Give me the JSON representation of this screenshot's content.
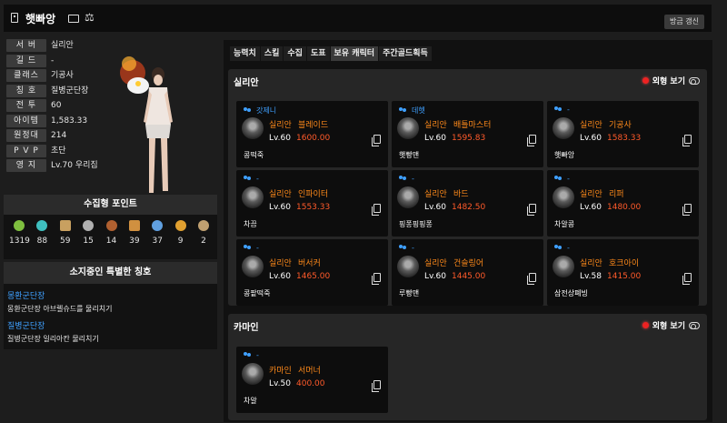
{
  "header": {
    "name": "햇빠앙",
    "refresh_label": "방금 갱신"
  },
  "profile": {
    "rows": [
      {
        "label": "서 버",
        "value": "실리안"
      },
      {
        "label": "길 드",
        "value": "-"
      },
      {
        "label": "클래스",
        "value": "기공사"
      },
      {
        "label": "칭 호",
        "value": "질병군단장"
      },
      {
        "label": "전 투",
        "value": "60"
      },
      {
        "label": "아이템",
        "value": "1,583.33"
      },
      {
        "label": "원정대",
        "value": "214"
      },
      {
        "label": "P V P",
        "value": "초단"
      },
      {
        "label": "영 지",
        "value": "Lv.70 우리집"
      }
    ]
  },
  "collect": {
    "title": "수집형 포인트",
    "items": [
      {
        "icon": "mokoko-seed-icon",
        "value": "1319",
        "color": "#7fbf3f"
      },
      {
        "icon": "island-heart-icon",
        "value": "88",
        "color": "#3fbfbf"
      },
      {
        "icon": "masterpiece-icon",
        "value": "59",
        "color": "#c8a060"
      },
      {
        "icon": "giants-heart-icon",
        "value": "15",
        "color": "#b0b0b0"
      },
      {
        "icon": "ignea-token-icon",
        "value": "14",
        "color": "#b06030"
      },
      {
        "icon": "voyage-icon",
        "value": "39",
        "color": "#d09040"
      },
      {
        "icon": "world-tree-leaf-icon",
        "value": "37",
        "color": "#60a0e0"
      },
      {
        "icon": "orpheus-star-icon",
        "value": "9",
        "color": "#e0a030"
      },
      {
        "icon": "sea-bounty-icon",
        "value": "2",
        "color": "#c0a070"
      }
    ]
  },
  "special_titles": {
    "title": "소지중인 특별한 칭호",
    "items": [
      {
        "name": "몽환군단장",
        "desc": "몽환군단장 아브렐슈드를 물리치기"
      },
      {
        "name": "질병군단장",
        "desc": "질병군단장 일리아칸 물리치기"
      }
    ]
  },
  "tabs": [
    "능력치",
    "스킬",
    "수집",
    "도표",
    "보유 캐릭터",
    "주간골드획득"
  ],
  "active_tab": "보유 캐릭터",
  "servers": [
    {
      "name": "실리안",
      "toggle_label": "외형 보기",
      "characters": [
        {
          "guild": "갓제니",
          "server": "실리안",
          "class": "블레이드",
          "level": "Lv.60",
          "item_level": "1600.00",
          "name": "콩떡죽"
        },
        {
          "guild": "데헷",
          "server": "실리안",
          "class": "배틀마스터",
          "level": "Lv.60",
          "item_level": "1595.83",
          "name": "햇빵맨"
        },
        {
          "guild": "-",
          "server": "실리안",
          "class": "기공사",
          "level": "Lv.60",
          "item_level": "1583.33",
          "name": "햇빠앙"
        },
        {
          "guild": "-",
          "server": "실리안",
          "class": "인파이터",
          "level": "Lv.60",
          "item_level": "1553.33",
          "name": "차끔"
        },
        {
          "guild": "-",
          "server": "실리안",
          "class": "바드",
          "level": "Lv.60",
          "item_level": "1482.50",
          "name": "핑퐁핑핑퐁"
        },
        {
          "guild": "-",
          "server": "실리안",
          "class": "리퍼",
          "level": "Lv.60",
          "item_level": "1480.00",
          "name": "차알콩"
        },
        {
          "guild": "-",
          "server": "실리안",
          "class": "버서커",
          "level": "Lv.60",
          "item_level": "1465.00",
          "name": "콩팥떡죽"
        },
        {
          "guild": "-",
          "server": "실리안",
          "class": "건슬링어",
          "level": "Lv.60",
          "item_level": "1445.00",
          "name": "루빵맨"
        },
        {
          "guild": "-",
          "server": "실리안",
          "class": "호크아이",
          "level": "Lv.58",
          "item_level": "1415.00",
          "name": "삼전상폐빙"
        }
      ]
    },
    {
      "name": "카마인",
      "toggle_label": "외형 보기",
      "characters": [
        {
          "guild": "-",
          "server": "카마인",
          "class": "서머너",
          "level": "Lv.50",
          "item_level": "400.00",
          "name": "차알"
        }
      ]
    }
  ],
  "colors": {
    "accent_blue": "#3fa0ff",
    "accent_orange": "#ff8a1a",
    "item_level_red": "#ff5a2a",
    "toggle_red": "#ee2222"
  }
}
